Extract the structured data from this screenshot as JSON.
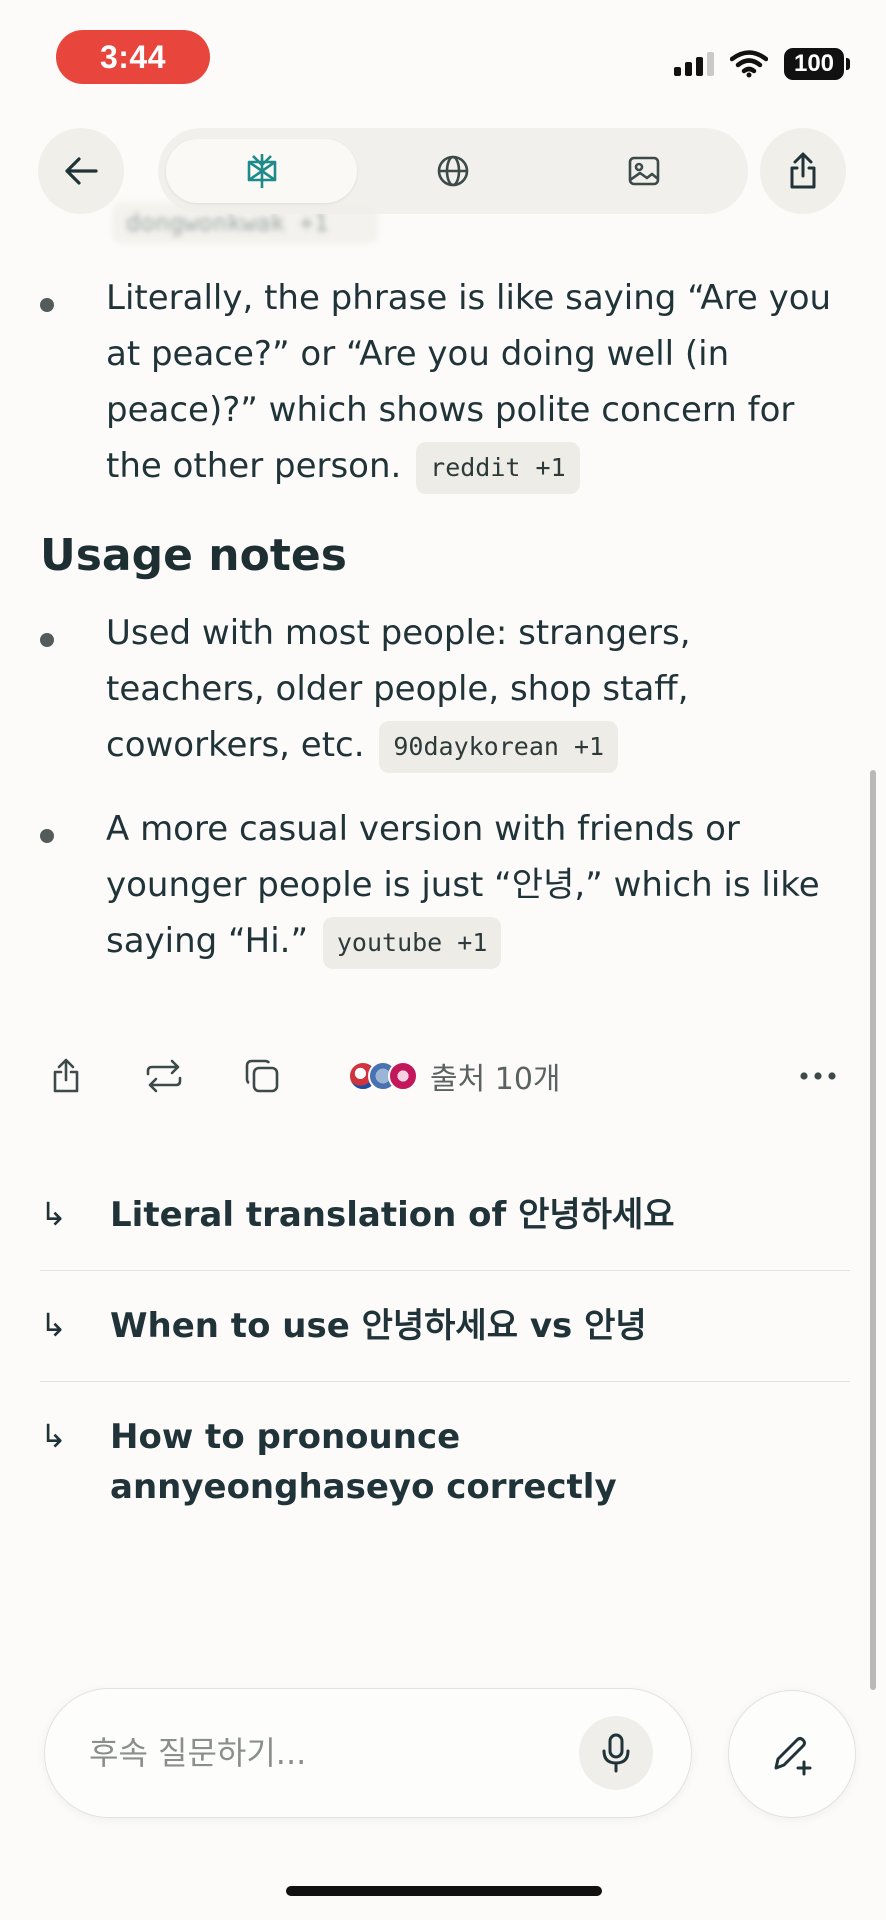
{
  "status_bar": {
    "time": "3:44",
    "battery": "100"
  },
  "background_chip": "dongwonkwak +1",
  "nav": {
    "tabs": [
      {
        "icon": "perplexity-logo-icon",
        "active": true
      },
      {
        "icon": "globe-icon",
        "active": false
      },
      {
        "icon": "image-icon",
        "active": false
      }
    ]
  },
  "content": {
    "first_bullet": {
      "text": "Literally, the phrase is like saying “Are you at peace?” or “Are you doing well (in peace)?” which shows polite concern for the other person.",
      "source": "reddit +1"
    },
    "section_title": "Usage notes",
    "bullets": [
      {
        "text": "Used with most people: strangers, teachers, older people, shop staff, coworkers, etc.",
        "source": "90daykorean +1"
      },
      {
        "text": "A more casual version with friends or younger people is just “안녕,” which is like saying “Hi.”",
        "source": "youtube +1"
      }
    ]
  },
  "actions": {
    "sources_label": "출처 10개"
  },
  "related": [
    {
      "arrow": "↳",
      "text": "Literal translation of 안녕하세요"
    },
    {
      "arrow": "↳",
      "text": "When to use 안녕하세요 vs 안녕"
    },
    {
      "arrow": "↳",
      "text": "How to pronounce annyeonghaseyo correctly"
    }
  ],
  "input": {
    "placeholder": "후속 질문하기..."
  },
  "colors": {
    "accent": "#1f8a8a",
    "time_pill": "#e8453c",
    "background": "#fcfbf9"
  }
}
